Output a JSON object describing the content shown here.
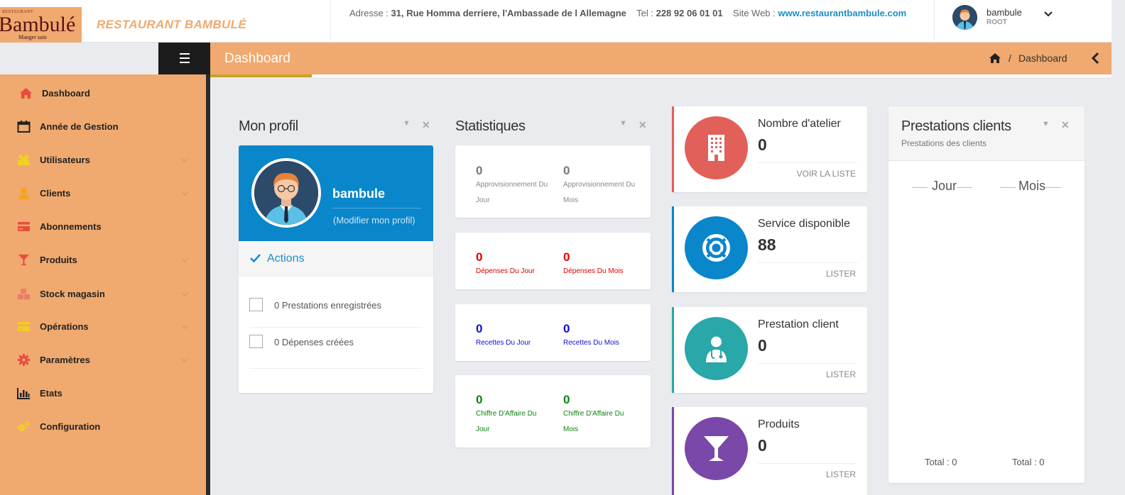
{
  "header": {
    "logo": {
      "small": "RESTAURANT",
      "big": "Bambulé",
      "tagline": "Manger sain"
    },
    "brand": "RESTAURANT BAMBULÉ",
    "address_label": "Adresse :",
    "address": "31, Rue Homma derriere, l'Ambassade de l Allemagne",
    "tel_label": "Tel :",
    "tel": "228 92 06 01 01",
    "site_label": "Site Web :",
    "site": "www.restaurantbambule.com",
    "user": {
      "name": "bambule",
      "role": "ROOT"
    }
  },
  "titlebar": {
    "title": "Dashboard",
    "breadcrumb": "Dashboard",
    "separator": "/"
  },
  "sidebar": {
    "items": [
      {
        "label": "Dashboard",
        "icon": "home-icon",
        "active": true,
        "expandable": false
      },
      {
        "label": "Année de Gestion",
        "icon": "calendar-icon",
        "expandable": false
      },
      {
        "label": "Utilisateurs",
        "icon": "users-icon",
        "expandable": true
      },
      {
        "label": "Clients",
        "icon": "user-icon",
        "expandable": true
      },
      {
        "label": "Abonnements",
        "icon": "credit-card-icon",
        "expandable": false
      },
      {
        "label": "Produits",
        "icon": "cocktail-icon",
        "expandable": true
      },
      {
        "label": "Stock magasin",
        "icon": "cubes-icon",
        "expandable": true
      },
      {
        "label": "Opérations",
        "icon": "card-icon",
        "expandable": true
      },
      {
        "label": "Paramètres",
        "icon": "cog-icon",
        "expandable": true
      },
      {
        "label": "Etats",
        "icon": "bar-chart-icon",
        "expandable": false
      },
      {
        "label": "Configuration",
        "icon": "cogs-icon",
        "expandable": false
      }
    ]
  },
  "profile": {
    "title": "Mon profil",
    "name": "bambule",
    "edit_link": "(Modifier mon profil)",
    "actions_label": "Actions",
    "tasks": [
      "0 Prestations enregistrées",
      "0 Dépenses créées"
    ]
  },
  "stats": {
    "title": "Statistiques",
    "cards": [
      {
        "color": "#777777",
        "items": [
          {
            "value": "0",
            "label": "Approvisionnement Du Jour"
          },
          {
            "value": "0",
            "label": "Approvisionnement Du Mois"
          }
        ]
      },
      {
        "color": "#e00000",
        "items": [
          {
            "value": "0",
            "label": "Dépenses Du Jour"
          },
          {
            "value": "0",
            "label": "Dépenses Du Mois"
          }
        ]
      },
      {
        "color": "#1010d0",
        "items": [
          {
            "value": "0",
            "label": "Recettes Du Jour"
          },
          {
            "value": "0",
            "label": "Recettes Du Mois"
          }
        ]
      },
      {
        "color": "#108010",
        "items": [
          {
            "value": "0",
            "label": "Chiffre D'Affaire Du Jour"
          },
          {
            "value": "0",
            "label": "Chiffre D'Affaire Du Mois"
          }
        ]
      }
    ]
  },
  "infoboxes": [
    {
      "title": "Nombre d'atelier",
      "value": "0",
      "link": "VOIR LA LISTE",
      "color": "#e2605a",
      "icon": "building-icon"
    },
    {
      "title": "Service disponible",
      "value": "88",
      "link": "LISTER",
      "color": "#0a86cb",
      "icon": "life-ring-icon"
    },
    {
      "title": "Prestation client",
      "value": "0",
      "link": "LISTER",
      "color": "#2aa7a8",
      "icon": "user-doctor-icon"
    },
    {
      "title": "Produits",
      "value": "0",
      "link": "LISTER",
      "color": "#7a48a8",
      "icon": "cocktail-icon"
    }
  ],
  "prestations": {
    "title": "Prestations clients",
    "subtitle": "Prestations des clients",
    "col_day": "Jour",
    "col_month": "Mois",
    "total_day": "Total : 0",
    "total_month": "Total : 0"
  }
}
